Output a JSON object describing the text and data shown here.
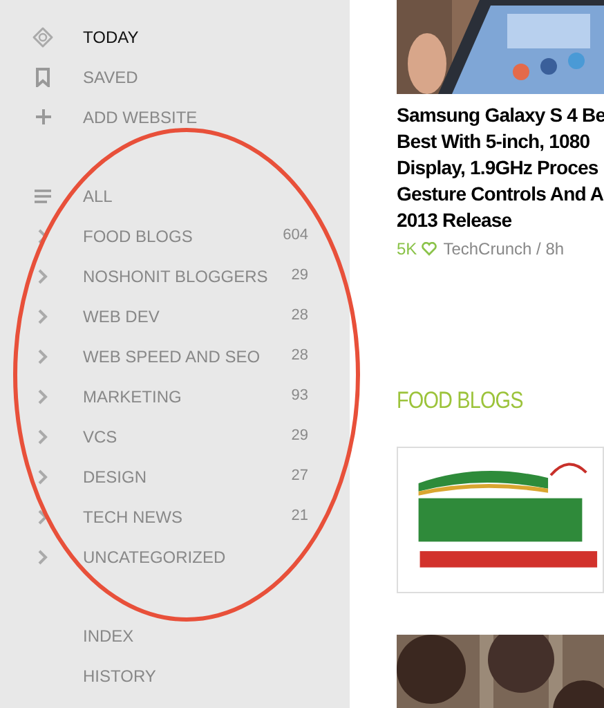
{
  "sidebar": {
    "nav": [
      {
        "label": "TODAY",
        "kind": "today",
        "selected": true
      },
      {
        "label": "SAVED",
        "kind": "saved",
        "selected": false
      },
      {
        "label": "ADD WEBSITE",
        "kind": "add",
        "selected": false
      }
    ],
    "all": {
      "label": "ALL"
    },
    "categories": [
      {
        "label": "FOOD BLOGS",
        "count": "604"
      },
      {
        "label": "NOSHONIT BLOGGERS",
        "count": "29"
      },
      {
        "label": "WEB DEV",
        "count": "28"
      },
      {
        "label": "WEB SPEED AND SEO",
        "count": "28"
      },
      {
        "label": "MARKETING",
        "count": "93"
      },
      {
        "label": "VCS",
        "count": "29"
      },
      {
        "label": "DESIGN",
        "count": "27"
      },
      {
        "label": "TECH NEWS",
        "count": "21"
      },
      {
        "label": "UNCATEGORIZED"
      }
    ],
    "links": [
      "INDEX",
      "HISTORY"
    ]
  },
  "article": {
    "title_lines": [
      "Samsung Galaxy S 4 Be",
      "Best With 5-inch, 1080",
      "Display, 1.9GHz Proces",
      "Gesture Controls And A",
      "2013 Release"
    ],
    "likes": "5K",
    "source": "TechCrunch / 8h"
  },
  "section": {
    "title": "FOOD BLOGS"
  }
}
